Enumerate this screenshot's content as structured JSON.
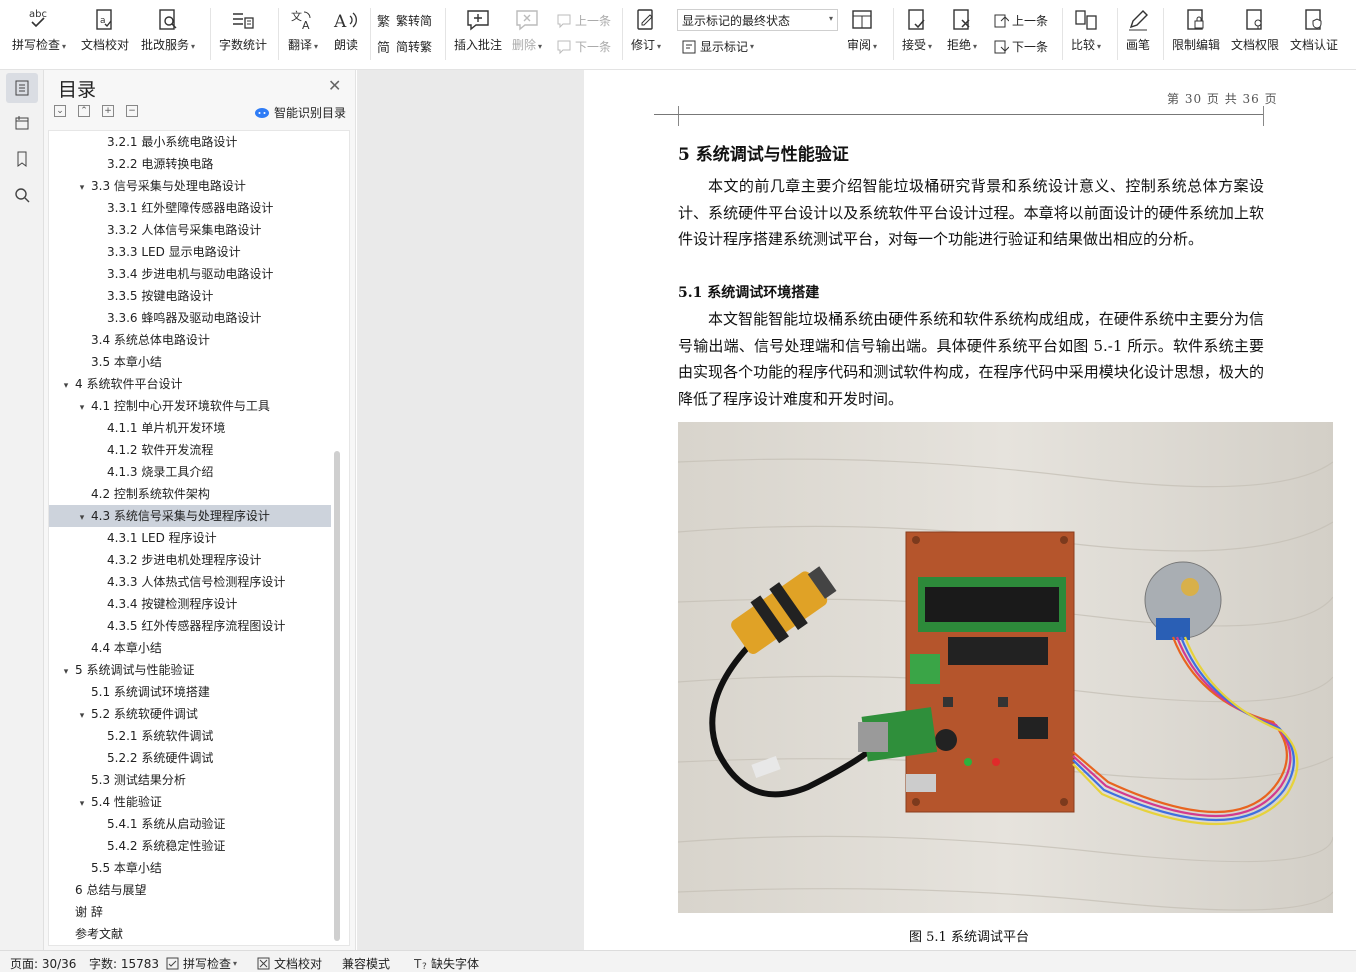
{
  "ribbon": {
    "spell_check": "拼写检查",
    "doc_proof": "文档校对",
    "batch_service": "批改服务",
    "word_count": "字数统计",
    "translate": "翻译",
    "read_aloud": "朗读",
    "trad_to_simp": "繁转简",
    "simp_to_trad": "简转繁",
    "insert_comment": "插入批注",
    "delete": "删除",
    "prev_comment": "上一条",
    "next_comment": "下一条",
    "track_changes": "修订",
    "markup_state": "显示标记的最终状态",
    "show_markup": "显示标记",
    "review": "审阅",
    "accept": "接受",
    "reject": "拒绝",
    "prev_change": "上一条",
    "next_change": "下一条",
    "compare": "比较",
    "ink": "画笔",
    "restrict_edit": "限制编辑",
    "doc_permission": "文档权限",
    "doc_cert": "文档认证"
  },
  "toc": {
    "title": "目录",
    "smart_toc": "智能识别目录",
    "items": [
      {
        "label": "3.2.1  最小系统电路设计",
        "level": 3,
        "toggle": ""
      },
      {
        "label": "3.2.2  电源转换电路",
        "level": 3,
        "toggle": ""
      },
      {
        "label": "3.3  信号采集与处理电路设计",
        "level": 2,
        "toggle": "v"
      },
      {
        "label": "3.3.1  红外壁障传感器电路设计",
        "level": 3,
        "toggle": ""
      },
      {
        "label": "3.3.2  人体信号采集电路设计",
        "level": 3,
        "toggle": ""
      },
      {
        "label": "3.3.3 LED 显示电路设计",
        "level": 3,
        "toggle": ""
      },
      {
        "label": "3.3.4  步进电机与驱动电路设计",
        "level": 3,
        "toggle": ""
      },
      {
        "label": "3.3.5  按键电路设计",
        "level": 3,
        "toggle": ""
      },
      {
        "label": "3.3.6  蜂鸣器及驱动电路设计",
        "level": 3,
        "toggle": ""
      },
      {
        "label": "3.4  系统总体电路设计",
        "level": 2,
        "toggle": ""
      },
      {
        "label": "3.5  本章小结",
        "level": 2,
        "toggle": ""
      },
      {
        "label": "4  系统软件平台设计",
        "level": 1,
        "toggle": "v"
      },
      {
        "label": "4.1  控制中心开发环境软件与工具",
        "level": 2,
        "toggle": "v"
      },
      {
        "label": "4.1.1  单片机开发环境",
        "level": 3,
        "toggle": ""
      },
      {
        "label": "4.1.2  软件开发流程",
        "level": 3,
        "toggle": ""
      },
      {
        "label": "4.1.3  烧录工具介绍",
        "level": 3,
        "toggle": ""
      },
      {
        "label": "4.2  控制系统软件架构",
        "level": 2,
        "toggle": ""
      },
      {
        "label": "4.3  系统信号采集与处理程序设计",
        "level": 2,
        "toggle": "v",
        "selected": true
      },
      {
        "label": "4.3.1 LED 程序设计",
        "level": 3,
        "toggle": ""
      },
      {
        "label": "4.3.2  步进电机处理程序设计",
        "level": 3,
        "toggle": ""
      },
      {
        "label": "4.3.3  人体热式信号检测程序设计",
        "level": 3,
        "toggle": ""
      },
      {
        "label": "4.3.4  按键检测程序设计",
        "level": 3,
        "toggle": ""
      },
      {
        "label": "4.3.5  红外传感器程序流程图设计",
        "level": 3,
        "toggle": ""
      },
      {
        "label": "4.4  本章小结",
        "level": 2,
        "toggle": ""
      },
      {
        "label": "5  系统调试与性能验证",
        "level": 1,
        "toggle": "v"
      },
      {
        "label": "5.1  系统调试环境搭建",
        "level": 2,
        "toggle": ""
      },
      {
        "label": "5.2  系统软硬件调试",
        "level": 2,
        "toggle": "v"
      },
      {
        "label": "5.2.1  系统软件调试",
        "level": 3,
        "toggle": ""
      },
      {
        "label": "5.2.2  系统硬件调试",
        "level": 3,
        "toggle": ""
      },
      {
        "label": "5.3  测试结果分析",
        "level": 2,
        "toggle": ""
      },
      {
        "label": "5.4  性能验证",
        "level": 2,
        "toggle": "v"
      },
      {
        "label": "5.4.1  系统从启动验证",
        "level": 3,
        "toggle": ""
      },
      {
        "label": "5.4.2  系统稳定性验证",
        "level": 3,
        "toggle": ""
      },
      {
        "label": "5.5  本章小结",
        "level": 2,
        "toggle": ""
      },
      {
        "label": "6  总结与展望",
        "level": 1,
        "toggle": ""
      },
      {
        "label": "谢    辞",
        "level": 1,
        "toggle": ""
      },
      {
        "label": "参考文献",
        "level": 1,
        "toggle": ""
      }
    ]
  },
  "document": {
    "page_indicator": "第 30 页 共 36 页",
    "chapter_title": "5  系统调试与性能验证",
    "para1": "本文的前几章主要介绍智能垃圾桶研究背景和系统设计意义、控制系统总体方案设计、系统硬件平台设计以及系统软件平台设计过程。本章将以前面设计的硬件系统加上软件设计程序搭建系统测试平台，对每一个功能进行验证和结果做出相应的分析。",
    "section_title": "5.1  系统调试环境搭建",
    "para2": "本文智能智能垃圾桶系统由硬件系统和软件系统构成组成，在硬件系统中主要分为信号输出端、信号处理端和信号输出端。具体硬件系统平台如图 5.-1 所示。软件系统主要由实现各个功能的程序代码和测试软件构成，在程序代码中采用模块化设计思想，极大的降低了程序设计难度和开发时间。",
    "figure_caption": "图 5.1 系统调试平台"
  },
  "status": {
    "page": "页面: 30/36",
    "words": "字数: 15783",
    "spell": "拼写检查",
    "proof": "文档校对",
    "compat": "兼容模式",
    "missing_font": "缺失字体"
  }
}
